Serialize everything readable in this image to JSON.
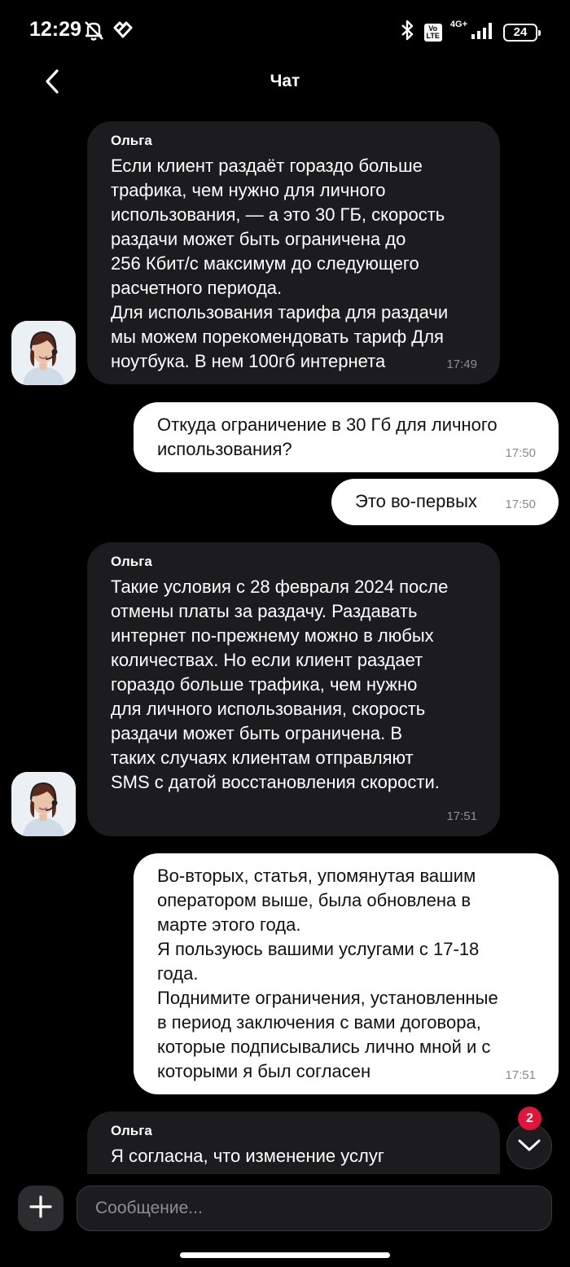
{
  "status_bar": {
    "time": "12:29",
    "network": "4G+",
    "volte": "Vo\nLTE",
    "battery": "24"
  },
  "header": {
    "title": "Чат"
  },
  "messages": [
    {
      "direction": "in",
      "sender": "Ольга",
      "text": "Если клиент раздаёт гораздо больше\nтрафика, чем нужно для личного\nиспользования, — а это 30 ГБ, скорость\nраздачи может быть ограничена до\n256 Кбит/с максимум до следующего\nрасчетного периода.\nДля использования тарифа для раздачи\nмы можем порекомендовать тариф Для\nноутбука. В нем 100гб интернета",
      "time": "17:49"
    },
    {
      "direction": "out",
      "text": "Откуда ограничение в 30 Гб для личного\nиспользования?",
      "time": "17:50"
    },
    {
      "direction": "out",
      "text": "Это во-первых",
      "time": "17:50"
    },
    {
      "direction": "in",
      "sender": "Ольга",
      "text": "Такие условия с 28 февраля 2024 после\nотмены платы за раздачу. Раздавать\nинтернет по-прежнему можно в любых\nколичествах. Но если клиент раздает\nгораздо больше трафика, чем нужно\nдля личного использования, скорость\nраздачи может быть ограничена. В\nтаких случаях клиентам отправляют\nSMS с датой восстановления скорости.",
      "time": "17:51"
    },
    {
      "direction": "out",
      "text": "Во-вторых, статья, упомянутая вашим\nоператором выше, была обновлена в\nмарте этого года.\nЯ пользуюсь вашими услугами с 17-18\nгода.\nПоднимите ограничения, установленные\nв период заключения с вами договора,\nкоторые подписывались лично мной и с\nкоторыми я был согласен",
      "time": "17:51"
    },
    {
      "direction": "in",
      "sender": "Ольга",
      "text": "Я согласна, что изменение услуг",
      "time": ""
    }
  ],
  "scroll_button": {
    "unread_count": "2"
  },
  "composer": {
    "placeholder": "Сообщение..."
  }
}
